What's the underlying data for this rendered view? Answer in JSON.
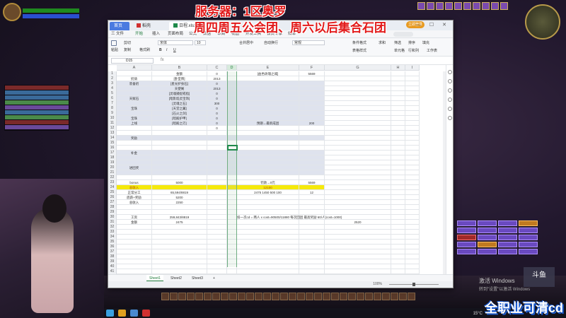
{
  "overlay": {
    "server_title": "服务器：1区奥罗",
    "schedule_title": "周四周五公会团、周六以后集合石团",
    "bottom_banner": "全职业可清cd",
    "activate_windows": "激活 Windows",
    "activate_sub": "转到\"设置\"以激活 Windows",
    "platform_logo": "斗鱼",
    "time": "15°C"
  },
  "app": {
    "tabs": [
      {
        "label": "首页"
      },
      {
        "label": "稻壳"
      },
      {
        "label": "日程.xlsx"
      }
    ],
    "login_button": "立即登录",
    "window_controls": "— ☐ ✕",
    "menus": [
      "三 文件",
      "开始",
      "插入",
      "页面布局",
      "公式",
      "数据",
      "审阅",
      "视图",
      "开发工具",
      "会员专享",
      "效率"
    ],
    "active_menu": "开始",
    "ribbon": {
      "paste": "粘贴",
      "cut": "剪切",
      "copy": "复制",
      "format_painter": "格式刷",
      "font": "宋体",
      "font_size": "10",
      "merge": "合并居中",
      "wrap": "自动换行",
      "number_format": "常规",
      "cond_format": "条件格式",
      "table_style": "表格样式",
      "sum": "求和",
      "filter": "筛选",
      "sort": "排序",
      "fill": "填充",
      "cells": "单元格",
      "rows_cols": "行和列",
      "worksheet": "工作表",
      "freeze": "冻结窗格"
    },
    "namebox": "D15",
    "fx": "fx",
    "columns": [
      "A",
      "B",
      "C",
      "D",
      "E",
      "F",
      "G",
      "H",
      "I"
    ],
    "rows": [
      {
        "n": "1",
        "a": "",
        "b": "金额",
        "c": "0",
        "e": "[血色玫瑰之城]",
        "f": "5569"
      },
      {
        "n": "2",
        "a": "奶骑",
        "b": "[卧室牌]",
        "c": "2013",
        "e": "",
        "f": ""
      },
      {
        "n": "3",
        "a": "",
        "b": "[星光护身石]",
        "c": "0",
        "e": "",
        "f": ""
      },
      {
        "n": "4",
        "a": "",
        "b": "天使阁",
        "c": "2013",
        "e": "",
        "f": ""
      },
      {
        "n": "5",
        "a": "",
        "b": "[灵魂捕捉戒指]",
        "c": "0",
        "e": "",
        "f": ""
      },
      {
        "n": "6",
        "a": "",
        "b": "[暗影焰灵宝饰]",
        "c": "0",
        "e": "",
        "f": ""
      },
      {
        "n": "7",
        "a": "",
        "b": "[灵魂之石]",
        "c": "300",
        "e": "",
        "f": ""
      },
      {
        "n": "8",
        "a": "",
        "b": "[天堂之翼]",
        "c": "0",
        "e": "",
        "f": ""
      },
      {
        "n": "9",
        "a": "",
        "b": "[石火之剑]",
        "c": "0",
        "e": "",
        "f": ""
      },
      {
        "n": "10",
        "a": "",
        "b": "[暗殿护甲]",
        "c": "0",
        "e": "",
        "f": ""
      },
      {
        "n": "11",
        "a": "",
        "b": "[暗殿之刃]",
        "c": "0",
        "e": "预期→最新成团",
        "f": "200"
      },
      {
        "n": "12",
        "a": "",
        "b": "",
        "c": "0",
        "e": "",
        "f": ""
      },
      {
        "n": "13",
        "a": "",
        "b": "",
        "c": "",
        "e": "",
        "f": ""
      },
      {
        "n": "14",
        "a": "",
        "b": "",
        "c": "",
        "e": "",
        "f": ""
      },
      {
        "n": "15",
        "a": "",
        "b": "",
        "c": "",
        "e": "",
        "f": ""
      },
      {
        "n": "16",
        "a": "",
        "b": "",
        "c": "",
        "e": "",
        "f": ""
      },
      {
        "n": "17",
        "a": "",
        "b": "",
        "c": "",
        "e": "",
        "f": ""
      },
      {
        "n": "18",
        "a": "",
        "b": "",
        "c": "",
        "e": "",
        "f": ""
      },
      {
        "n": "19",
        "a": "",
        "b": "",
        "c": "",
        "e": "",
        "f": ""
      },
      {
        "n": "20",
        "a": "",
        "b": "",
        "c": "",
        "e": "",
        "f": ""
      },
      {
        "n": "21",
        "a": "",
        "b": "",
        "c": "",
        "e": "",
        "f": ""
      },
      {
        "n": "22",
        "a": "",
        "b": "",
        "c": "",
        "e": "",
        "f": ""
      },
      {
        "n": "23",
        "a": "bonus",
        "b": "5000",
        "c": "",
        "e": "罚款→0元",
        "f": "5569"
      },
      {
        "n": "24",
        "a": "总收入",
        "b": "",
        "c": "",
        "e": "",
        "f": ""
      },
      {
        "n": "25",
        "a": "正常分工",
        "b": "65,594/8819",
        "c": "",
        "e": "",
        "f": ""
      },
      {
        "n": "26",
        "a": "底薪+奖励",
        "b": "5200",
        "c": "",
        "e": "",
        "f": ""
      },
      {
        "n": "27",
        "a": "总收入",
        "b": "2250",
        "c": "",
        "e": "",
        "f": ""
      },
      {
        "n": "28",
        "a": "",
        "b": "",
        "c": "",
        "e": "",
        "f": ""
      },
      {
        "n": "29",
        "a": "",
        "b": "",
        "c": "",
        "e": "",
        "f": ""
      },
      {
        "n": "30",
        "a": "工资",
        "b": "259,843/8819",
        "c": "",
        "e": "",
        "f": ""
      },
      {
        "n": "31",
        "a": "金额",
        "b": "2475",
        "c": "",
        "e": "",
        "f": ""
      },
      {
        "n": "32",
        "a": "",
        "b": "",
        "c": "",
        "e": "",
        "f": ""
      },
      {
        "n": "33",
        "a": "",
        "b": "",
        "c": "",
        "e": "",
        "f": ""
      },
      {
        "n": "34",
        "a": "",
        "b": "",
        "c": "",
        "e": "",
        "f": ""
      },
      {
        "n": "35",
        "a": "",
        "b": "",
        "c": "",
        "e": "",
        "f": ""
      },
      {
        "n": "36",
        "a": "",
        "b": "",
        "c": "",
        "e": "",
        "f": ""
      },
      {
        "n": "37",
        "a": "",
        "b": "",
        "c": "",
        "e": "",
        "f": ""
      },
      {
        "n": "38",
        "a": "",
        "b": "",
        "c": "",
        "e": "",
        "f": ""
      },
      {
        "n": "39",
        "a": "",
        "b": "",
        "c": "",
        "e": "",
        "f": ""
      },
      {
        "n": "40",
        "a": "",
        "b": "",
        "c": "",
        "e": "",
        "f": ""
      },
      {
        "n": "41",
        "a": "",
        "b": "",
        "c": "",
        "e": "",
        "f": ""
      }
    ],
    "row_labels": {
      "row3_a": "装备奶",
      "row6_a": "天赋石",
      "row8_a": "宝珠",
      "row10_a": "宝珠",
      "row11_a": "上线",
      "row14_a": "奖励",
      "row17_a": "补金",
      "row20_a": "进团奖"
    },
    "summary_text": "5000",
    "row24_value": "12100",
    "row25_value_e": "2475 1450 500 100",
    "row25_value_f": "12",
    "note_row30": "扣一次cd = 两人 x cost=90500/11880 每次回团 最高奖励 60/人(cost=1000)",
    "row31_g": "2520",
    "sheets": [
      "Sheet1",
      "Sheet2",
      "Sheet3"
    ],
    "active_sheet": "Sheet1",
    "zoom": "100%",
    "zoom_fraction": 0.5
  },
  "colors": {
    "accent": "#1f8a4a",
    "tab_blue": "#4a7ae0",
    "highlight_yellow": "#f5e90c",
    "overlay_red": "#e21a1a"
  }
}
